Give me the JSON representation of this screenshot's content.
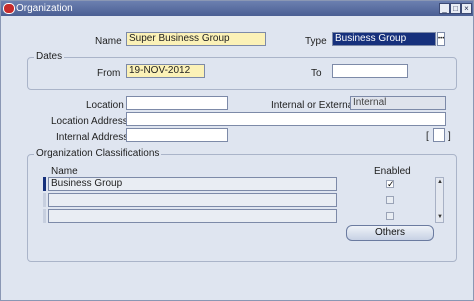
{
  "window": {
    "title": "Organization",
    "controls": {
      "minimize": "_",
      "maximize": "□",
      "close": "×"
    }
  },
  "header": {
    "name_label": "Name",
    "name_value": "Super Business Group",
    "type_label": "Type",
    "type_value": "Business Group",
    "type_lov_glyph": "•••"
  },
  "dates": {
    "group_title": "Dates",
    "from_label": "From",
    "from_value": "19-NOV-2012",
    "to_label": "To",
    "to_value": ""
  },
  "location": {
    "location_label": "Location",
    "location_value": "",
    "internal_external_label": "Internal or External",
    "internal_external_value": "Internal",
    "location_address_label": "Location Address",
    "location_address_value": "",
    "internal_address_label": "Internal Address",
    "internal_address_value": "",
    "flex_open": "[",
    "flex_value": "",
    "flex_close": "]"
  },
  "classifications": {
    "group_title": "Organization Classifications",
    "col_name": "Name",
    "col_enabled": "Enabled",
    "rows": [
      {
        "name": "Business Group",
        "enabled": "✓"
      },
      {
        "name": "",
        "enabled": ""
      },
      {
        "name": "",
        "enabled": ""
      }
    ],
    "others_button": "Others"
  },
  "colors": {
    "title_bar": "#4b5f93",
    "required_field": "#fbf1b7",
    "selected_field": "#16307c",
    "window_bg": "#dfe5f0"
  }
}
